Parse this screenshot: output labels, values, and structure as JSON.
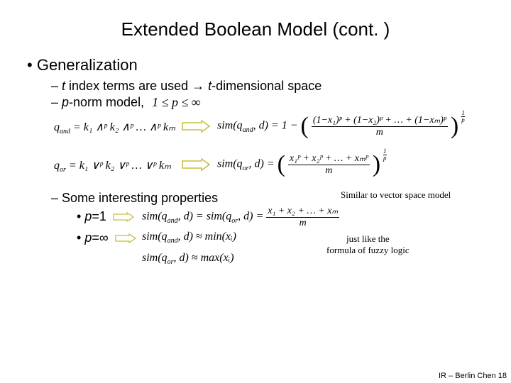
{
  "title": "Extended Boolean Model (cont. )",
  "l1": {
    "generalization": "Generalization"
  },
  "l2": {
    "tindex_pre": "t",
    "tindex_mid": " index terms are used → ",
    "tindex_ital": "t",
    "tindex_post": "-dimensional space",
    "pnorm_ital": "p",
    "pnorm_post": "-norm model, ",
    "range": "1 ≤ p ≤ ∞",
    "props": "Some interesting properties"
  },
  "l3": {
    "p1_ital": "p",
    "p1_after": "=1",
    "pinf_ital": "p",
    "pinf_after": "="
  },
  "formulas": {
    "qand": "q",
    "qand_sub": "and",
    "qand_body": " = k₁ ∧ᵖ k₂ ∧ᵖ … ∧ᵖ kₘ",
    "qor": "q",
    "qor_sub": "or",
    "qor_body": " = k₁ ∨ᵖ k₂ ∨ᵖ … ∨ᵖ kₘ",
    "sim_and_lhs": "sim(q",
    "sim_and_lhs_sub": "and",
    "sim_and_lhs2": ", d) = 1 − ",
    "sim_and_num": "(1−x₁)ᵖ + (1−x₂)ᵖ + … + (1−xₘ)ᵖ",
    "sim_and_den": "m",
    "sim_or_lhs": "sim(q",
    "sim_or_lhs_sub": "or",
    "sim_or_lhs2": ", d) = ",
    "sim_or_num": "x₁ᵖ + x₂ᵖ + … + xₘᵖ",
    "sim_or_den": "m",
    "exp_num": "1",
    "exp_den": "p",
    "p1formula_lhs": "sim(q",
    "p1formula_sub1": "and",
    "p1formula_mid": ", d) = sim(q",
    "p1formula_sub2": "or",
    "p1formula_rhs": ", d) = ",
    "p1_num": "x₁ + x₂ + … + xₘ",
    "p1_den": "m",
    "pinf_and": "sim(q",
    "pinf_and_sub": "and",
    "pinf_and_rhs": ", d) ≈ min(xᵢ)",
    "pinf_or": "sim(q",
    "pinf_or_sub": "or",
    "pinf_or_rhs": ", d) ≈ max(xᵢ)"
  },
  "notes": {
    "vector": "Similar to vector space model",
    "fuzzy1": "just like the",
    "fuzzy2": "formula of fuzzy logic"
  },
  "footer": "IR – Berlin Chen 18"
}
